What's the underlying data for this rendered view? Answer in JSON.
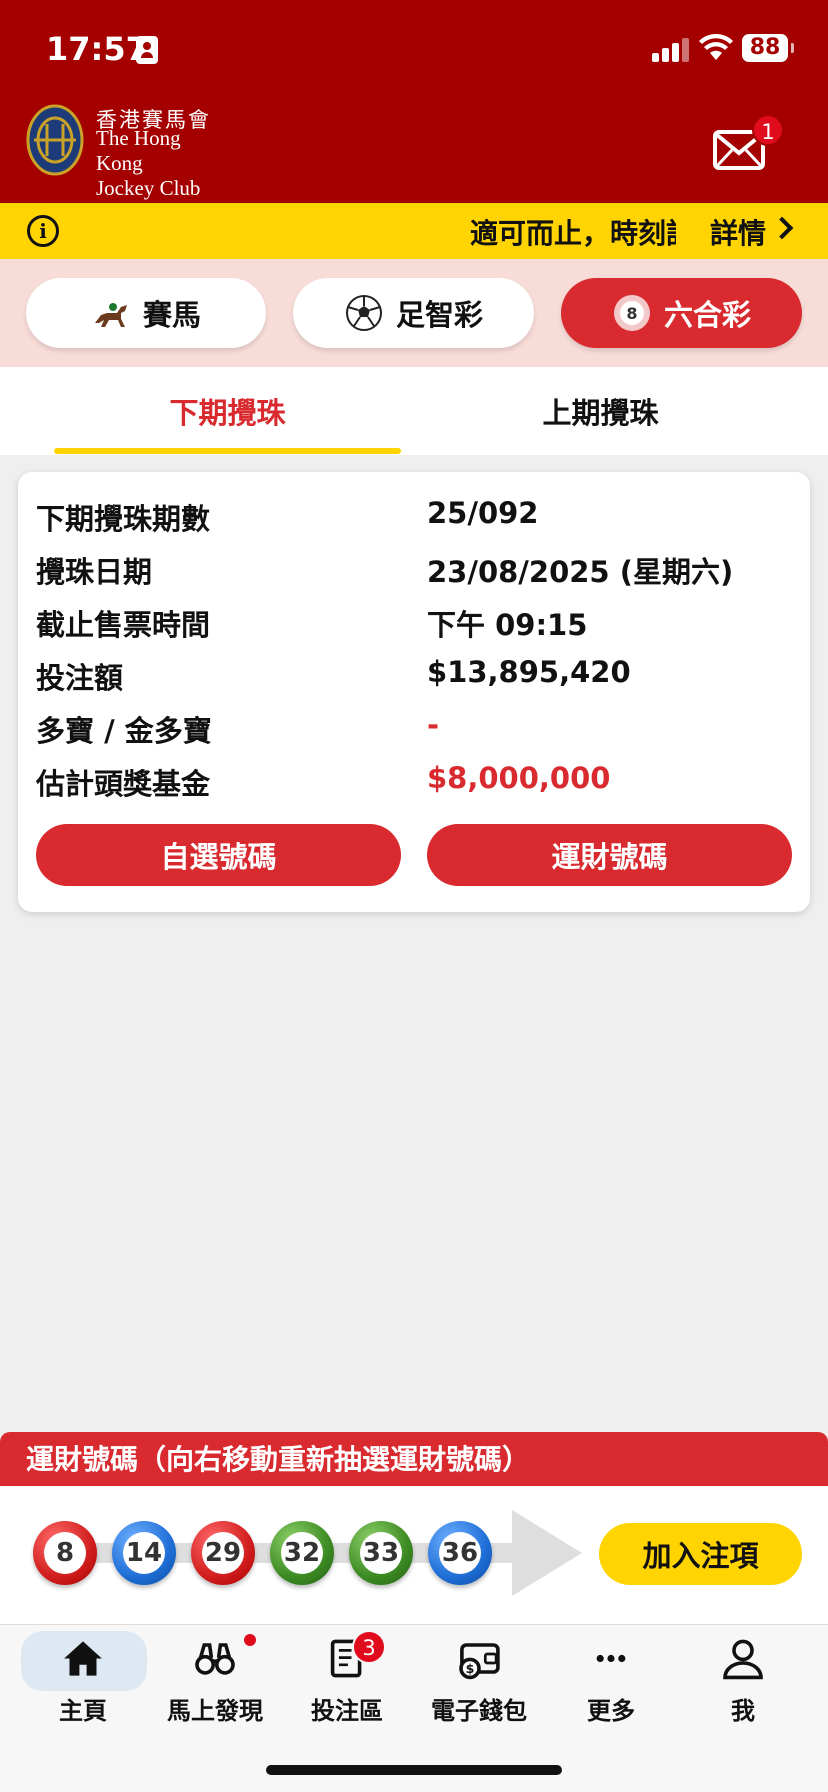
{
  "status_bar": {
    "time": "17:57",
    "battery": "88"
  },
  "header": {
    "logo_cn": "香港賽馬會",
    "logo_en_line1": "The Hong Kong",
    "logo_en_line2": "Jockey Club",
    "mail_badge": "1"
  },
  "notice": {
    "text": "適可而止，時刻記",
    "detail": "詳情"
  },
  "products": [
    {
      "label": "賽馬",
      "icon": "racehorse-icon"
    },
    {
      "label": "足智彩",
      "icon": "football-icon"
    },
    {
      "label": "六合彩",
      "icon": "lottery-ball-icon",
      "active": true
    }
  ],
  "tabs": [
    {
      "label": "下期攪珠",
      "active": true
    },
    {
      "label": "上期攪珠"
    }
  ],
  "draw_info": {
    "rows": [
      {
        "label": "下期攪珠期數",
        "value": "25/092"
      },
      {
        "label": "攪珠日期",
        "value": "23/08/2025 (星期六)"
      },
      {
        "label": "截止售票時間",
        "value": "下午 09:15"
      },
      {
        "label": "投注額",
        "value": "$13,895,420"
      },
      {
        "label": "多寶 / 金多寶",
        "value": "-"
      },
      {
        "label": "估計頭獎基金",
        "value": "$8,000,000"
      }
    ],
    "buttons": {
      "self_pick": "自選號碼",
      "lucky_pick": "運財號碼"
    }
  },
  "lucky_numbers": {
    "title": "運財號碼（向右移動重新抽選運財號碼）",
    "balls": [
      {
        "number": "8",
        "color": "red"
      },
      {
        "number": "14",
        "color": "blue"
      },
      {
        "number": "29",
        "color": "red"
      },
      {
        "number": "32",
        "color": "green"
      },
      {
        "number": "33",
        "color": "green"
      },
      {
        "number": "36",
        "color": "blue"
      }
    ],
    "add_button": "加入注項"
  },
  "bottom_nav": {
    "items": [
      {
        "label": "主頁",
        "icon": "home-icon",
        "active": true
      },
      {
        "label": "馬上發現",
        "icon": "binoculars-icon"
      },
      {
        "label": "投注區",
        "icon": "betslip-icon",
        "badge": "3"
      },
      {
        "label": "電子錢包",
        "icon": "wallet-icon"
      },
      {
        "label": "更多",
        "icon": "more-icon"
      },
      {
        "label": "我",
        "icon": "profile-icon"
      }
    ]
  },
  "colors": {
    "brand_red": "#a40000",
    "accent_red": "#d92b2f",
    "yellow": "#ffd400"
  }
}
